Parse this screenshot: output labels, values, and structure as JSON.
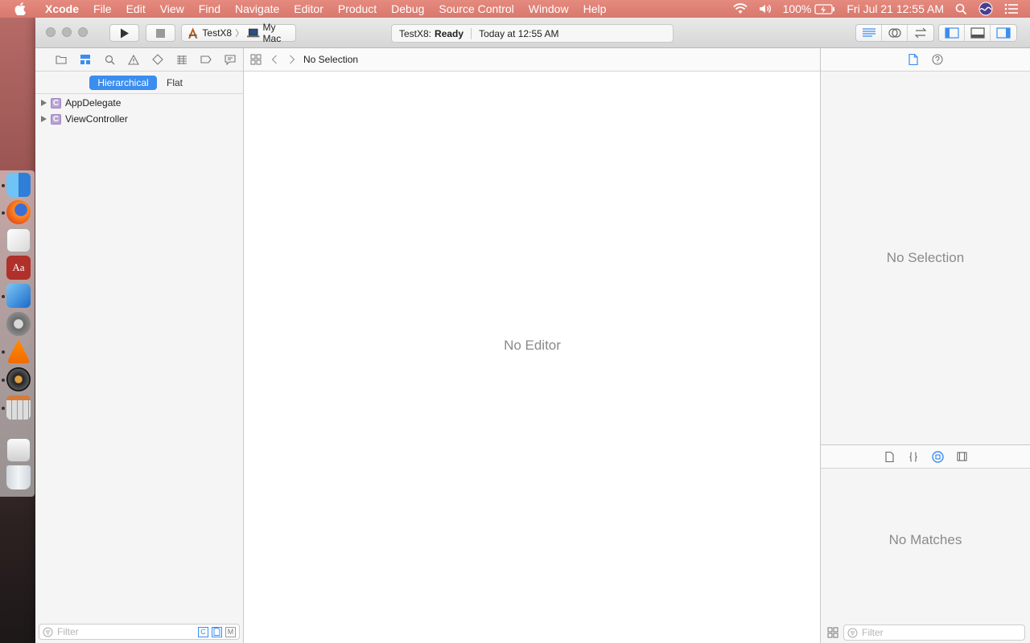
{
  "menubar": {
    "app_name": "Xcode",
    "items": [
      "File",
      "Edit",
      "View",
      "Find",
      "Navigate",
      "Editor",
      "Product",
      "Debug",
      "Source Control",
      "Window",
      "Help"
    ],
    "battery": "100%",
    "clock": "Fri Jul 21  12:55 AM"
  },
  "toolbar": {
    "scheme": "TestX8",
    "destination": "My Mac",
    "activity_project": "TestX8:",
    "activity_status": "Ready",
    "activity_time": "Today at 12:55 AM"
  },
  "navigator": {
    "hierarchical_label": "Hierarchical",
    "flat_label": "Flat",
    "items": [
      {
        "badge": "C",
        "label": "AppDelegate"
      },
      {
        "badge": "C",
        "label": "ViewController"
      }
    ],
    "filter_placeholder": "Filter",
    "filter_buttons": [
      "C",
      "",
      "M"
    ]
  },
  "editor": {
    "jump_label": "No Selection",
    "empty_label": "No Editor"
  },
  "inspector": {
    "empty_label": "No Selection",
    "library_empty_label": "No Matches",
    "filter_placeholder": "Filter"
  },
  "colors": {
    "accent": "#3b8df0",
    "menubar": "#d9786e"
  }
}
